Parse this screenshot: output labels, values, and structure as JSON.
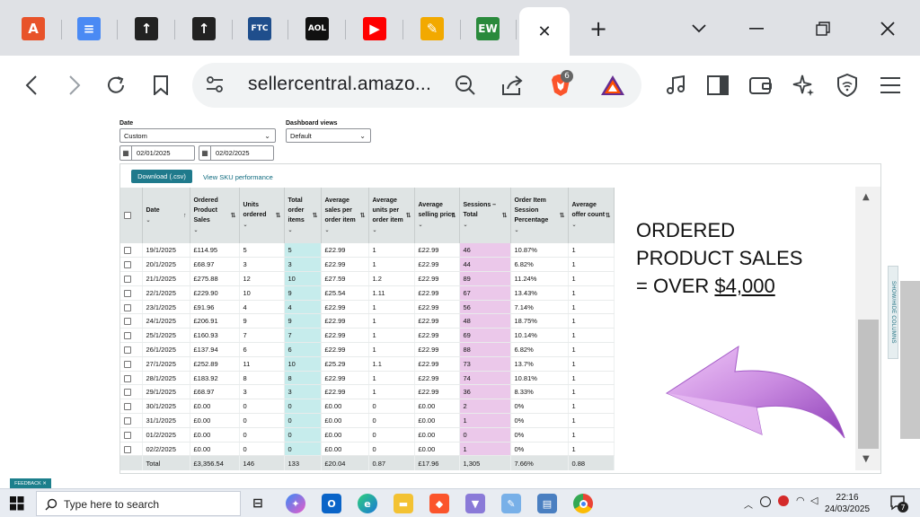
{
  "browser": {
    "tabs": [
      {
        "name": "tab-a",
        "glyph": "A",
        "color": "#e8532a"
      },
      {
        "name": "tab-docs",
        "glyph": "≡",
        "color": "#4a8af4"
      },
      {
        "name": "tab-stocks-1",
        "glyph": "↑",
        "color": "#222222"
      },
      {
        "name": "tab-stocks-2",
        "glyph": "↑",
        "color": "#222222"
      },
      {
        "name": "tab-ftc",
        "glyph": "FTC",
        "color": "#1f4e8c"
      },
      {
        "name": "tab-aol",
        "glyph": "AOL",
        "color": "#111111"
      },
      {
        "name": "tab-youtube",
        "glyph": "▶",
        "color": "#ff0000"
      },
      {
        "name": "tab-fire",
        "glyph": "✎",
        "color": "#f2a900"
      },
      {
        "name": "tab-ew",
        "glyph": "EW",
        "color": "#2a8a3c"
      }
    ],
    "active_tab_close": "✕",
    "new_tab": "+",
    "url": "sellercentral.amazo...",
    "brave_badge": "6"
  },
  "controls": {
    "date_label": "Date",
    "date_value": "Custom",
    "views_label": "Dashboard views",
    "views_value": "Default",
    "date_from": "02/01/2025",
    "date_to": "02/02/2025",
    "download_label": "Download (.csv)",
    "sku_link": "View SKU performance"
  },
  "table": {
    "headers": [
      "Date",
      "Ordered Product Sales",
      "Units ordered",
      "Total order items",
      "Average sales per order item",
      "Average units per order item",
      "Average selling price",
      "Sessions – Total",
      "Order Item Session Percentage",
      "Average offer count"
    ],
    "rows": [
      [
        "19/1/2025",
        "£114.95",
        "5",
        "5",
        "£22.99",
        "1",
        "£22.99",
        "46",
        "10.87%",
        "1"
      ],
      [
        "20/1/2025",
        "£68.97",
        "3",
        "3",
        "£22.99",
        "1",
        "£22.99",
        "44",
        "6.82%",
        "1"
      ],
      [
        "21/1/2025",
        "£275.88",
        "12",
        "10",
        "£27.59",
        "1.2",
        "£22.99",
        "89",
        "11.24%",
        "1"
      ],
      [
        "22/1/2025",
        "£229.90",
        "10",
        "9",
        "£25.54",
        "1.11",
        "£22.99",
        "67",
        "13.43%",
        "1"
      ],
      [
        "23/1/2025",
        "£91.96",
        "4",
        "4",
        "£22.99",
        "1",
        "£22.99",
        "56",
        "7.14%",
        "1"
      ],
      [
        "24/1/2025",
        "£206.91",
        "9",
        "9",
        "£22.99",
        "1",
        "£22.99",
        "48",
        "18.75%",
        "1"
      ],
      [
        "25/1/2025",
        "£160.93",
        "7",
        "7",
        "£22.99",
        "1",
        "£22.99",
        "69",
        "10.14%",
        "1"
      ],
      [
        "26/1/2025",
        "£137.94",
        "6",
        "6",
        "£22.99",
        "1",
        "£22.99",
        "88",
        "6.82%",
        "1"
      ],
      [
        "27/1/2025",
        "£252.89",
        "11",
        "10",
        "£25.29",
        "1.1",
        "£22.99",
        "73",
        "13.7%",
        "1"
      ],
      [
        "28/1/2025",
        "£183.92",
        "8",
        "8",
        "£22.99",
        "1",
        "£22.99",
        "74",
        "10.81%",
        "1"
      ],
      [
        "29/1/2025",
        "£68.97",
        "3",
        "3",
        "£22.99",
        "1",
        "£22.99",
        "36",
        "8.33%",
        "1"
      ],
      [
        "30/1/2025",
        "£0.00",
        "0",
        "0",
        "£0.00",
        "0",
        "£0.00",
        "2",
        "0%",
        "1"
      ],
      [
        "31/1/2025",
        "£0.00",
        "0",
        "0",
        "£0.00",
        "0",
        "£0.00",
        "1",
        "0%",
        "1"
      ],
      [
        "01/2/2025",
        "£0.00",
        "0",
        "0",
        "£0.00",
        "0",
        "£0.00",
        "0",
        "0%",
        "1"
      ],
      [
        "02/2/2025",
        "£0.00",
        "0",
        "0",
        "£0.00",
        "0",
        "£0.00",
        "1",
        "0%",
        "1"
      ]
    ],
    "total": [
      "Total",
      "£3,356.54",
      "146",
      "133",
      "£20.04",
      "0.87",
      "£17.96",
      "1,305",
      "7.66%",
      "0.88"
    ]
  },
  "overlay": {
    "line1": "ORDERED",
    "line2": "PRODUCT SALES",
    "line3_prefix": "= OVER ",
    "line3_amount": "$4,000",
    "arrow_color": "#c07ad8"
  },
  "side_tab": "SHOW/HIDE COLUMNS",
  "feedback": "FEEDBACK ✕",
  "taskbar": {
    "search_placeholder": "Type here to search",
    "time": "22:16",
    "date": "24/03/2025",
    "notifications": "7"
  }
}
